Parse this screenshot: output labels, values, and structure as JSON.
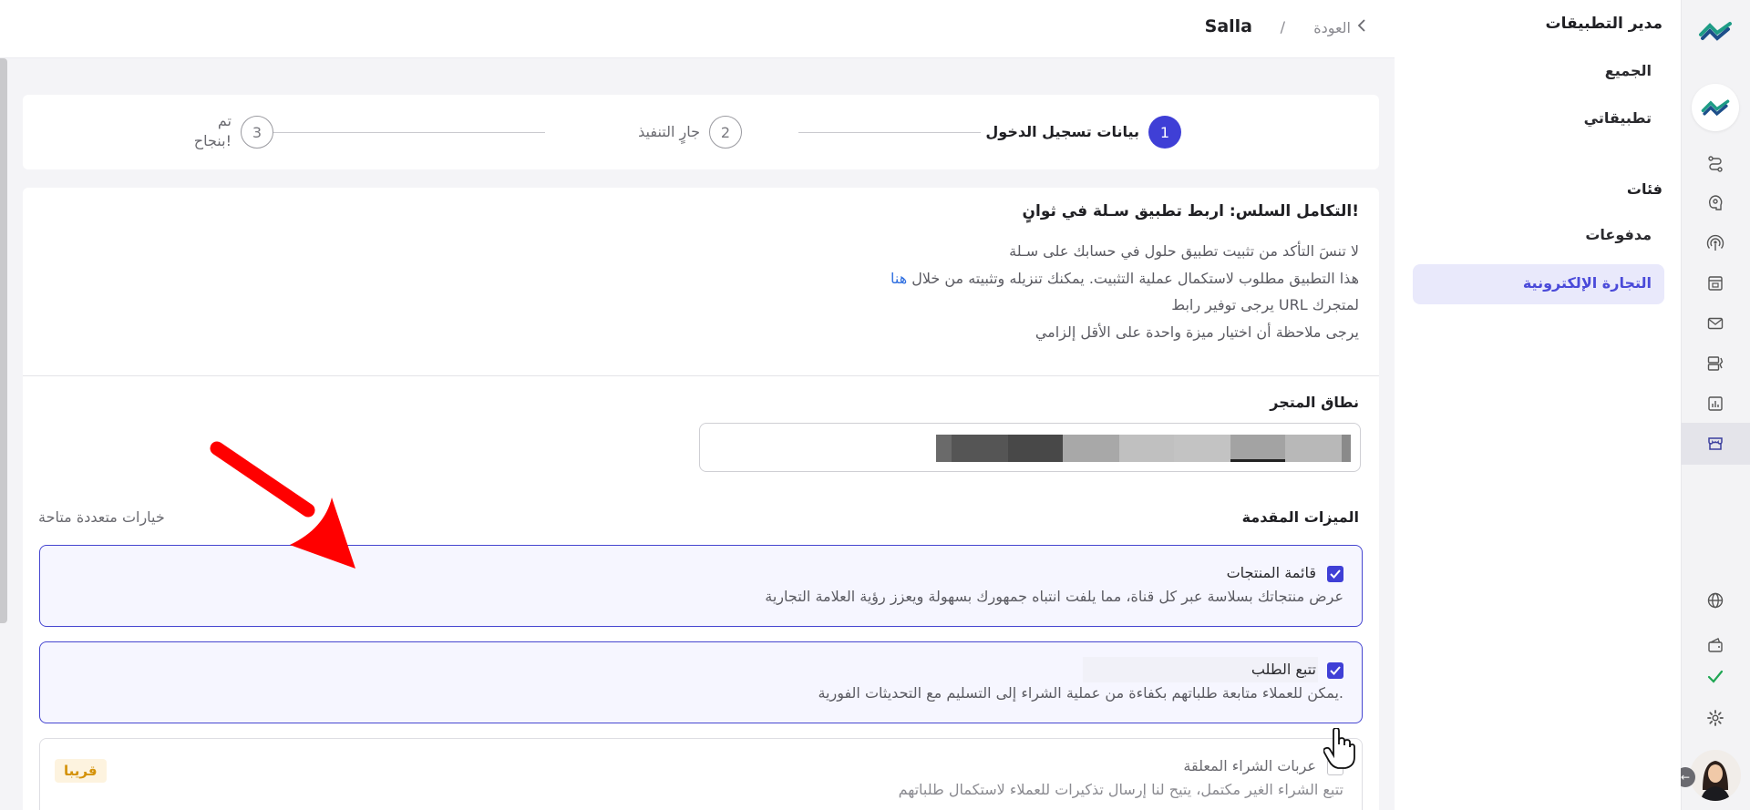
{
  "app": {
    "sidebar_title": "مدير التطبيقات",
    "nav": {
      "all": "الجميع",
      "my_apps": "تطبيقاتي",
      "categories_heading": "فئات",
      "payments": "مدفوعات",
      "ecommerce": "التجارة الإلكترونية"
    }
  },
  "header": {
    "back_label": "العودة",
    "separator": "/",
    "title": "Salla"
  },
  "stepper": {
    "steps": [
      {
        "number": "1",
        "label": "بيانات تسجيل الدخول"
      },
      {
        "number": "2",
        "label": "جارٍ التنفيذ"
      },
      {
        "number": "3",
        "label_line1": "تم",
        "label_line2": "بنجاح!"
      }
    ]
  },
  "info": {
    "title": "التكامل السلس: اربط تطبيق سـلة في ثوانٍ!",
    "line1": "لا تنسَ التأكد من تثبيت تطبيق حلول في حسابك على سـلة",
    "line2_text": "هذا التطبيق مطلوب لاستكمال عملية التثبيت. يمكنك تنزيله وتثبيته من خلال",
    "line2_link": "هنا",
    "line3": "يرجى توفير رابط URL لمتجرك",
    "line4": "يرجى ملاحظة أن اختيار ميزة واحدة على الأقل إلزامي"
  },
  "form": {
    "domain_label": "نطاق المتجر",
    "advanced_label": "الميزات المقدمة",
    "multi_label": "خيارات متعددة متاحة"
  },
  "features": [
    {
      "title": "قائمة المنتجات",
      "description": "عرض منتجاتك بسلاسة عبر كل قناة، مما يلفت انتباه جمهورك بسهولة ويعزز رؤية العلامة التجارية",
      "checked": true
    },
    {
      "title": "تتبع الطلب",
      "description": "يمكن للعملاء متابعة طلباتهم بكفاءة من عملية الشراء إلى التسليم مع التحديثات الفورية.",
      "checked": true
    },
    {
      "title": "عربات الشراء المعلقة",
      "description": "تتبع الشراء الغير مكتمل، يتيح لنا إرسال تذكيرات للعملاء لاستكمال طلباتهم",
      "checked": false,
      "badge": "قريبا"
    }
  ],
  "colors": {
    "accent": "#3f3fd6",
    "active_nav_bg": "#e9e9fb",
    "soon_badge": "#d4920a",
    "annotation_arrow": "#ff0000"
  }
}
